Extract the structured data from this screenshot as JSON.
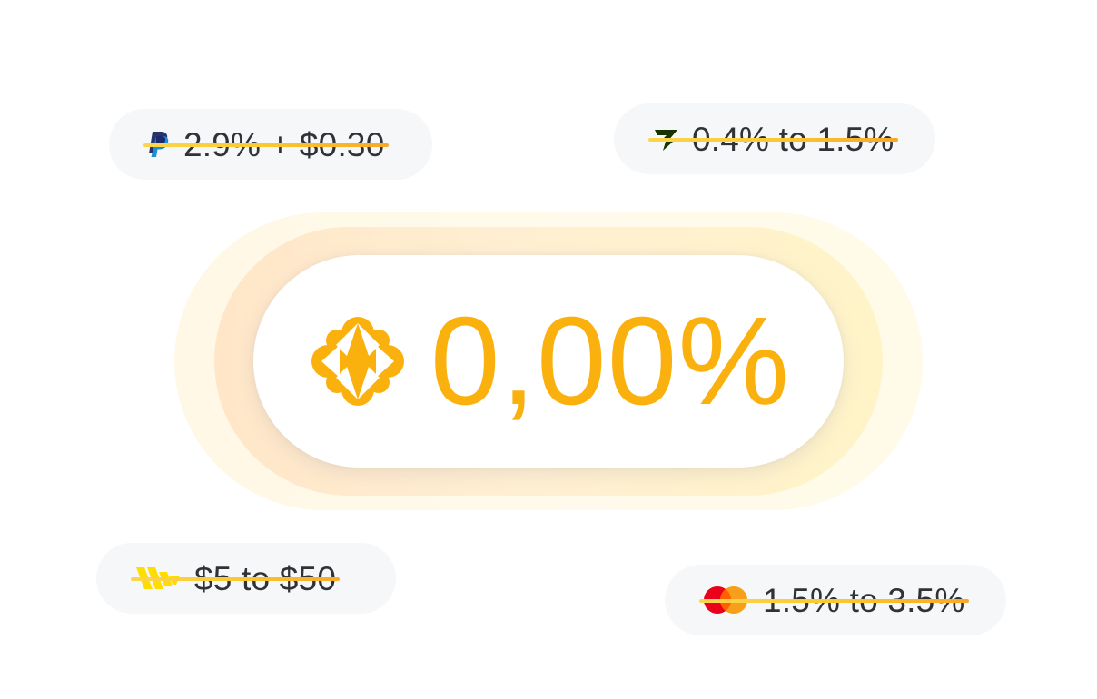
{
  "colors": {
    "accent": "#fbb10d",
    "pill_background": "#f6f7f9",
    "fee_text": "#2f3237",
    "strike_start": "#fbd54e",
    "strike_end": "#f9a826"
  },
  "center": {
    "logo_icon": "diamond-flower-logo-icon",
    "rate": "0,00%"
  },
  "fees": {
    "paypal": {
      "icon": "paypal-logo-icon",
      "text": "2.9% + $0.30"
    },
    "wise": {
      "icon": "wise-logo-icon",
      "text": "0.4% to 1.5%"
    },
    "western_union": {
      "icon": "western-union-logo-icon",
      "text": "$5 to $50"
    },
    "mastercard": {
      "icon": "mastercard-logo-icon",
      "text": "1.5% to 3.5%"
    }
  }
}
